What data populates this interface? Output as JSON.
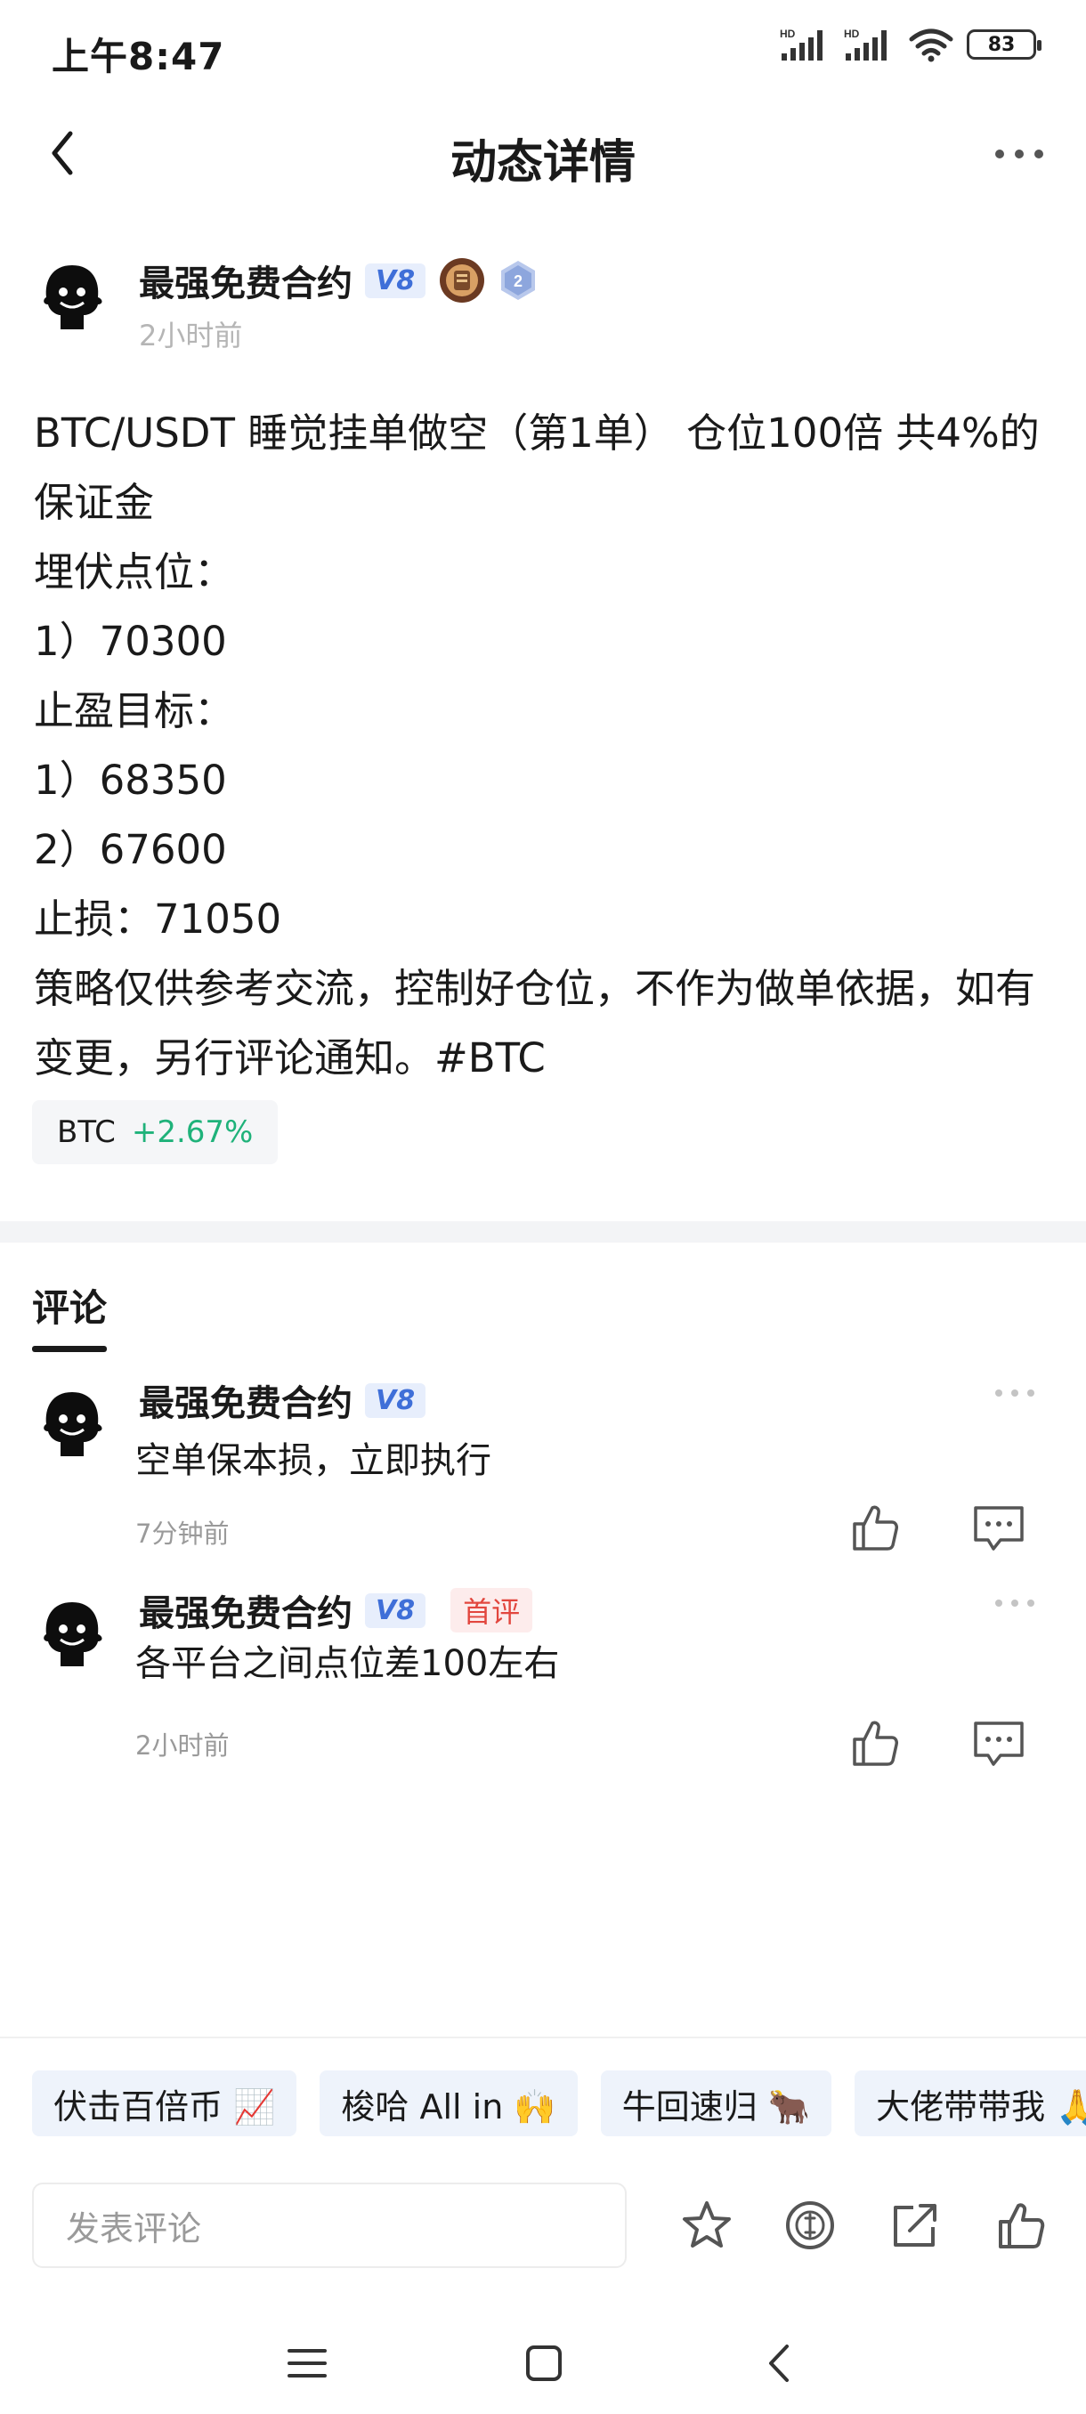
{
  "status_bar": {
    "time": "上午8:47",
    "signal1": "HD",
    "signal2": "HD",
    "battery": "83"
  },
  "header": {
    "title": "动态详情"
  },
  "post": {
    "author": "最强免费合约",
    "vip": "V8",
    "level": "2",
    "time": "2小时前",
    "lines": [
      "BTC/USDT 睡觉挂单做空（第1单） 仓位100倍 共4%的保证金",
      "埋伏点位：",
      "1）70300",
      "止盈目标：",
      "1）68350",
      "2）67600",
      "止损：71050",
      "策略仅供参考交流，控制好仓位，不作为做单依据，如有变更，另行评论通知。#BTC"
    ],
    "coin": {
      "symbol": "BTC",
      "change": "+2.67%",
      "change_color": "#1fb27a"
    }
  },
  "comments": {
    "tab_label": "评论",
    "items": [
      {
        "author": "最强免费合约",
        "vip": "V8",
        "badge": "",
        "text": "空单保本损，立即执行",
        "time": "7分钟前"
      },
      {
        "author": "最强免费合约",
        "vip": "V8",
        "badge": "首评",
        "text": "各平台之间点位差100左右",
        "time": "2小时前"
      }
    ]
  },
  "quick_tags": [
    "伏击百倍币 📈",
    "梭哈 All in 🙌",
    "牛回速归 🐂",
    "大佬带带我 🙏"
  ],
  "input": {
    "placeholder": "发表评论"
  },
  "icons": {
    "bottom_bar": [
      "star-icon",
      "coin-icon",
      "share-icon",
      "like-icon"
    ],
    "nav": [
      "menu-icon",
      "home-icon",
      "back-icon"
    ]
  },
  "colors": {
    "vip_text": "#3f6fd8",
    "vip_bg": "#e7eefc",
    "first_badge": "#e2463e",
    "tag_bg": "#eef3fb"
  }
}
